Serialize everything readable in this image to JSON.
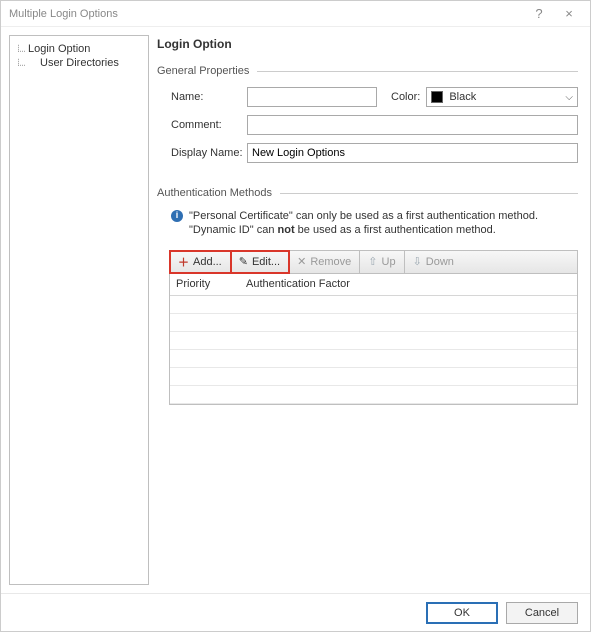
{
  "window": {
    "title": "Multiple Login Options",
    "help_glyph": "?",
    "close_glyph": "×"
  },
  "tree": {
    "items": [
      {
        "label": "Login Option"
      },
      {
        "label": "User Directories"
      }
    ]
  },
  "page": {
    "title": "Login Option"
  },
  "general": {
    "section_label": "General Properties",
    "name_label": "Name:",
    "name_value": "",
    "color_label": "Color:",
    "color_value": "Black",
    "color_hex": "#000000",
    "comment_label": "Comment:",
    "comment_value": "",
    "display_label": "Display Name:",
    "display_value": "New Login Options"
  },
  "auth": {
    "section_label": "Authentication Methods",
    "info_line1_pre": "\"Personal Certificate\" can only be used as a first authentication method.",
    "info_line2_pre": "\"Dynamic ID\" can ",
    "info_line2_bold": "not",
    "info_line2_post": " be used as a first authentication method.",
    "toolbar": {
      "add": "Add...",
      "edit": "Edit...",
      "remove": "Remove",
      "up": "Up",
      "down": "Down"
    },
    "columns": {
      "priority": "Priority",
      "factor": "Authentication Factor"
    },
    "rows": []
  },
  "footer": {
    "ok": "OK",
    "cancel": "Cancel"
  }
}
